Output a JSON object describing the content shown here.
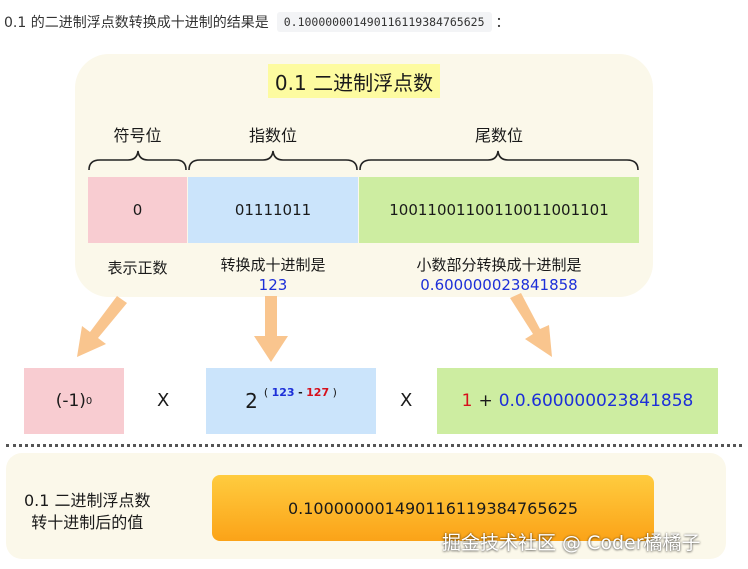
{
  "intro": {
    "text": "0.1 的二进制浮点数转换成十进制的结果是",
    "code": "0.100000001490116119384765625",
    "suffix": "："
  },
  "diagram": {
    "title": "0.1 二进制浮点数",
    "headers": {
      "sign": "符号位",
      "exponent": "指数位",
      "mantissa": "尾数位"
    },
    "bits": {
      "sign": "0",
      "exponent": "01111011",
      "mantissa": "10011001100110011001101"
    },
    "labels": {
      "sign": "表示正数",
      "exponent": "转换成十进制是",
      "exponent_value": "123",
      "mantissa": "小数部分转换成十进制是",
      "mantissa_value": "0.600000023841858"
    },
    "formula": {
      "sign_base": "(-1)",
      "sign_exp": "0",
      "times": "X",
      "exp_base": "2",
      "exp_paren_open": "(",
      "exp_a": "123",
      "exp_minus": "-",
      "exp_b": "127",
      "exp_paren_close": ")",
      "man_one": "1",
      "man_plus": "+",
      "man_value": "0.0.600000023841858"
    },
    "result": {
      "label_line1": "0.1 二进制浮点数",
      "label_line2": "转十进制后的值",
      "value": "0.100000001490116119384765625"
    },
    "watermark": "掘金技术社区 @ Coder橘橘子",
    "colors": {
      "panel": "#fbf8ea",
      "title": "#fdfba0",
      "sign": "#f8ccd1",
      "exponent": "#cbe4fb",
      "mantissa": "#cdeda1",
      "result": "#fba318",
      "arrow": "#f9c58e",
      "blue": "#1d2fd8",
      "red": "#d6101c"
    }
  }
}
